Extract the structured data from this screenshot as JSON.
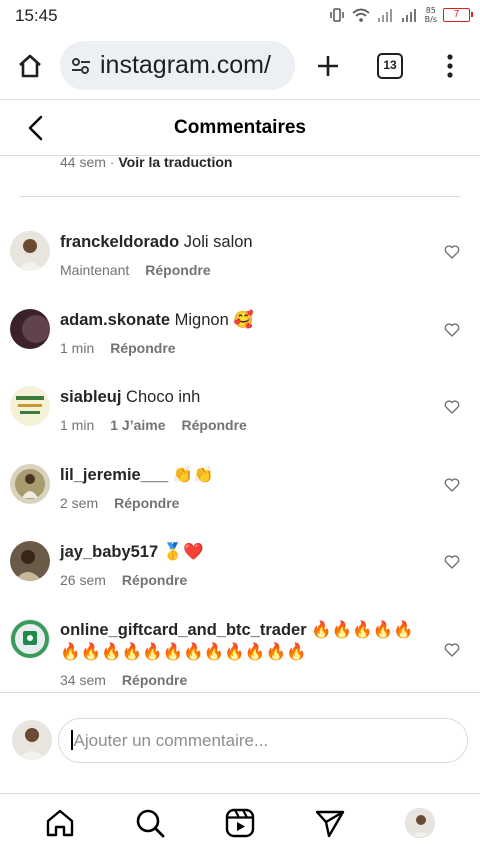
{
  "status": {
    "time": "15:45",
    "net_speed_value": "85",
    "net_speed_unit": "B/s",
    "battery": "7"
  },
  "browser": {
    "url": "instagram.com/",
    "tab_count": "13"
  },
  "header": {
    "title": "Commentaires"
  },
  "previous": {
    "time": "44 sem",
    "separator": " · ",
    "translate": "Voir la traduction"
  },
  "comments": [
    {
      "user": "franckeldorado",
      "text": "Joli salon",
      "time": "Maintenant",
      "likes": "",
      "reply": "Répondre"
    },
    {
      "user": "adam.skonate",
      "text": "Mignon 🥰",
      "time": "1 min",
      "likes": "",
      "reply": "Répondre"
    },
    {
      "user": "siableuj",
      "text": "Choco inh",
      "time": "1 min",
      "likes": "1 J’aime",
      "reply": "Répondre"
    },
    {
      "user": "lil_jeremie___",
      "text": "👏👏",
      "time": "2 sem",
      "likes": "",
      "reply": "Répondre"
    },
    {
      "user": "jay_baby517",
      "text": "🥇❤️",
      "time": "26 sem",
      "likes": "",
      "reply": "Répondre"
    },
    {
      "user": "online_giftcard_and_btc_trader",
      "text": "🔥🔥🔥🔥🔥🔥🔥🔥🔥🔥🔥🔥🔥🔥🔥🔥🔥",
      "time": "34 sem",
      "likes": "",
      "reply": "Répondre"
    }
  ],
  "compose": {
    "placeholder": "Ajouter un commentaire..."
  },
  "nav": {
    "items": [
      "home-icon",
      "search-icon",
      "reels-icon",
      "direct-icon",
      "profile-avatar"
    ]
  },
  "colors": {
    "meta_gray": "#737373",
    "divider": "#dbdbdb",
    "battery_red": "#dd2222"
  }
}
